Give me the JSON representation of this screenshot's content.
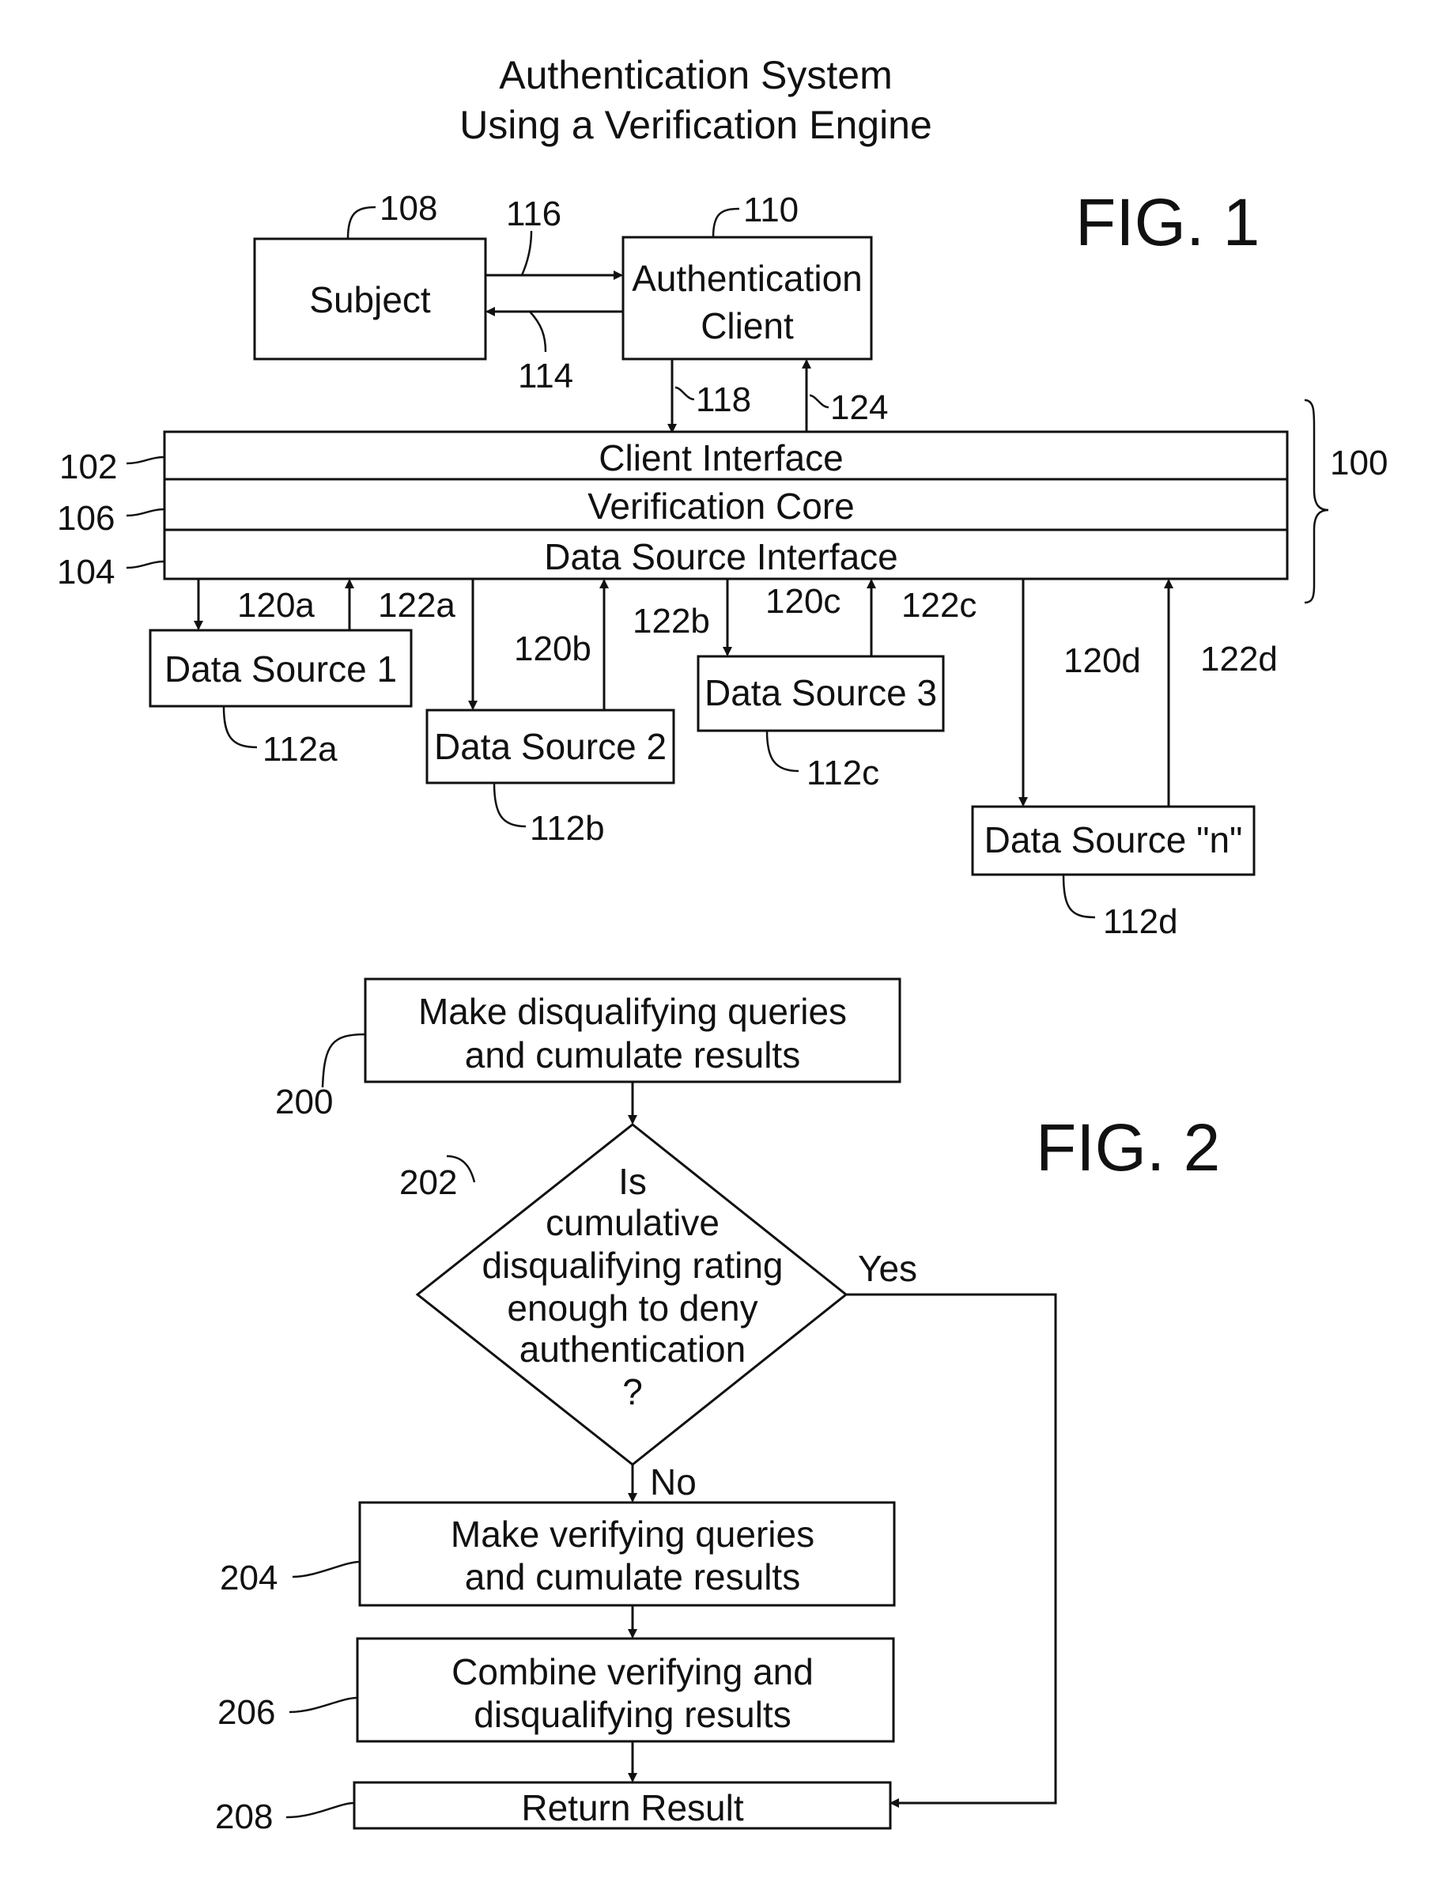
{
  "title": {
    "line1": "Authentication System",
    "line2": "Using a Verification Engine"
  },
  "fig1": {
    "label": "FIG. 1",
    "subject": {
      "label": "Subject",
      "ref": "108"
    },
    "auth_client": {
      "line1": "Authentication",
      "line2": "Client",
      "ref": "110"
    },
    "arrows": {
      "a116": "116",
      "a114": "114",
      "a118": "118",
      "a124": "124"
    },
    "engine": {
      "ref": "100",
      "layers": [
        {
          "label": "Client Interface",
          "ref": "102"
        },
        {
          "label": "Verification Core",
          "ref": "106"
        },
        {
          "label": "Data Source Interface",
          "ref": "104"
        }
      ]
    },
    "data_sources": [
      {
        "label": "Data Source 1",
        "ref": "112a",
        "out": "120a",
        "in": "122a"
      },
      {
        "label": "Data Source 2",
        "ref": "112b",
        "out": "120b",
        "in": "122b"
      },
      {
        "label": "Data Source 3",
        "ref": "112c",
        "out": "120c",
        "in": "122c"
      },
      {
        "label": "Data Source \"n\"",
        "ref": "112d",
        "out": "120d",
        "in": "122d"
      }
    ]
  },
  "fig2": {
    "label": "FIG. 2",
    "steps": [
      {
        "ref": "200",
        "line1": "Make disqualifying queries",
        "line2": "and cumulate results"
      },
      {
        "ref": "204",
        "line1": "Make verifying queries",
        "line2": "and cumulate results"
      },
      {
        "ref": "206",
        "line1": "Combine verifying and",
        "line2": "disqualifying results"
      },
      {
        "ref": "208",
        "line1": "Return Result"
      }
    ],
    "decision": {
      "ref": "202",
      "lines": [
        "Is",
        "cumulative",
        "disqualifying rating",
        "enough to deny",
        "authentication",
        "?"
      ],
      "yes": "Yes",
      "no": "No"
    }
  }
}
